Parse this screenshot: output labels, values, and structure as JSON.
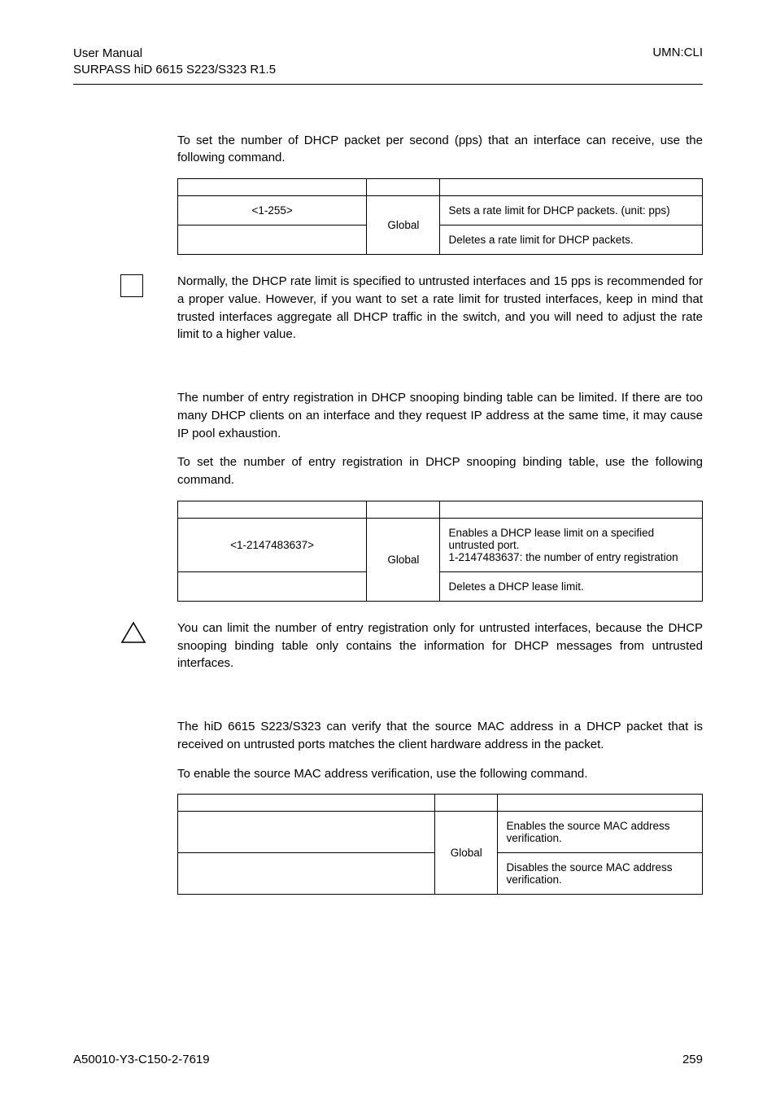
{
  "header": {
    "left_line1": "User Manual",
    "left_line2": "SURPASS hiD 6615 S223/S323 R1.5",
    "right": "UMN:CLI"
  },
  "intro_rate": "To set the number of DHCP packet per second (pps) that an interface can receive, use the following command.",
  "table_rate": {
    "cmd1": "<1-255>",
    "mode": "Global",
    "desc1": "Sets a rate limit for DHCP packets. (unit: pps)",
    "desc2": "Deletes a rate limit for DHCP packets."
  },
  "note_rate": "Normally, the DHCP rate limit is specified to untrusted interfaces and 15 pps is recommended for a proper value. However, if you want to set a rate limit for trusted interfaces, keep in mind that trusted interfaces aggregate all DHCP traffic in the switch, and you will need to adjust the rate limit to a higher value.",
  "intro_lease_1": "The number of entry registration in DHCP snooping binding table can be limited. If there are too many DHCP clients on an interface and they request IP address at the same time, it may cause IP pool exhaustion.",
  "intro_lease_2": "To set the number of entry registration in DHCP snooping binding table, use the following command.",
  "table_lease": {
    "cmd1": "<1-2147483637>",
    "mode": "Global",
    "desc1a": "Enables a DHCP lease limit on a specified untrusted port.",
    "desc1b": "1-2147483637: the number of entry registration",
    "desc2": "Deletes a DHCP lease limit."
  },
  "note_lease": "You can limit the number of entry registration only for untrusted interfaces, because the DHCP snooping binding table only contains the information for DHCP messages from untrusted interfaces.",
  "intro_verify_1": "The hiD 6615 S223/S323 can verify that the source MAC address in a DHCP packet that is received on untrusted ports matches the client hardware address in the packet.",
  "intro_verify_2": "To enable the source MAC address verification, use the following command.",
  "table_verify": {
    "mode": "Global",
    "desc1": "Enables the source MAC address verification.",
    "desc2": "Disables the source MAC address verification."
  },
  "footer": {
    "left": "A50010-Y3-C150-2-7619",
    "right": "259"
  }
}
